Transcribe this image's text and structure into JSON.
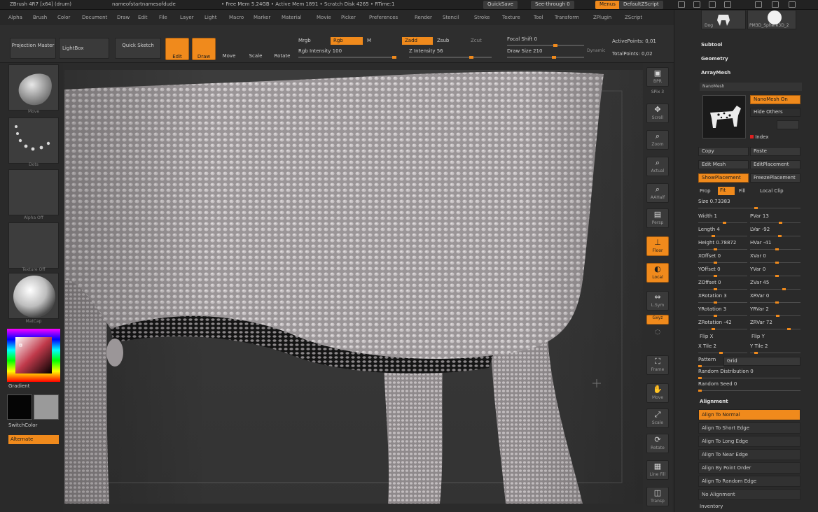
{
  "titlebar": {
    "app_title": "ZBrush 4R7 [x64] (drum)",
    "doc_title": "nameofstartnamesofdude",
    "stats": "• Free Mem 5.24GB • Active Mem 1891 • Scratch Disk 4265 • RTime:1",
    "quicksave": "QuickSave",
    "see_through": "See-through 0",
    "menus_button": "Menus",
    "script_button": "DefaultZScript"
  },
  "menubar": [
    "Alpha",
    "Brush",
    "Color",
    "Document",
    "Draw",
    "Edit",
    "File",
    "Layer",
    "Light",
    "Macro",
    "Marker",
    "Material",
    "Movie",
    "Picker",
    "Preferences",
    "Render",
    "Stencil",
    "Stroke",
    "Texture",
    "Tool",
    "Transform",
    "ZPlugin",
    "ZScript"
  ],
  "shelf": {
    "projection_master": "Projection Master",
    "lightbox": "LightBox",
    "quick_sketch": "Quick Sketch",
    "edit": "Edit",
    "draw": "Draw",
    "move": "Move",
    "scale": "Scale",
    "rotate": "Rotate",
    "mrgb": "Mrgb",
    "rgb": "Rgb",
    "m": "M",
    "zadd": "Zadd",
    "zsub": "Zsub",
    "zcut": "Zcut",
    "rgb_intensity": "Rgb Intensity 100",
    "z_intensity": "Z Intensity 56",
    "focal_shift": "Focal Shift 0",
    "draw_size": "Draw Size 210",
    "dynamic": "Dynamic",
    "active_points": "ActivePoints: 0,01",
    "total_points": "TotalPoints: 0,02"
  },
  "lefttray": {
    "brush_label": "Move",
    "stroke_label": "Dots",
    "alpha_label": "Alpha Off",
    "texture_label": "Texture Off",
    "material_label": "MatCap",
    "gradient": "Gradient",
    "switch_color": "SwitchColor",
    "alternate": "Alternate"
  },
  "rshelf": {
    "bpr": "BPR",
    "spix": "SPix 3",
    "scroll": "Scroll",
    "zoom": "Zoom",
    "actual": "Actual",
    "aahalf": "AAHalf",
    "persp": "Persp",
    "floor": "Floor",
    "local": "Local",
    "lsym": "L.Sym",
    "xyz": "Gxyz",
    "frame": "Frame",
    "move": "Move",
    "scale": "Scale",
    "rotate": "Rotate",
    "linefill": "Line Fill",
    "transp": "Transp"
  },
  "rpanel": {
    "tool_thumb_1": "Dog",
    "tool_thumb_2": "PM3D_Sphere3D_2",
    "subtool": "Subtool",
    "geometry": "Geometry",
    "arraymesh": "ArrayMesh",
    "nanomesh": "NanoMesh",
    "nanomesh_on": "NanoMesh On",
    "hide_others": "Hide Others",
    "index": "Index",
    "copy": "Copy",
    "paste": "Paste",
    "edit_mesh": "Edit Mesh",
    "edit_placement": "EditPlacement",
    "show_placement": "ShowPlacement",
    "freeze_placement": "FreezePlacement",
    "prop": "Prop",
    "fit": "Fit",
    "fill": "Fill",
    "local_clip": "Local Clip",
    "size": "Size 0.73383",
    "sliders": [
      {
        "label": "Width 1",
        "v": 0.55
      },
      {
        "label": "PVar 13",
        "v": 0.62
      },
      {
        "label": "Length 4",
        "v": 0.3
      },
      {
        "label": "LVar -92",
        "v": 0.6
      },
      {
        "label": "Height 0.78872",
        "v": 0.35
      },
      {
        "label": "HVar -41",
        "v": 0.55
      },
      {
        "label": "XOffset 0",
        "v": 0.35
      },
      {
        "label": "XVar 0",
        "v": 0.55
      },
      {
        "label": "YOffset 0",
        "v": 0.35
      },
      {
        "label": "YVar 0",
        "v": 0.55
      },
      {
        "label": "ZOffset 0",
        "v": 0.35
      },
      {
        "label": "ZVar 45",
        "v": 0.7
      },
      {
        "label": "XRotation 3",
        "v": 0.35
      },
      {
        "label": "XRVar 0",
        "v": 0.55
      },
      {
        "label": "YRotation 3",
        "v": 0.35
      },
      {
        "label": "YRVar 2",
        "v": 0.56
      },
      {
        "label": "ZRotation -42",
        "v": 0.3
      },
      {
        "label": "ZRVar 72",
        "v": 0.8
      }
    ],
    "flip_x": "Flip X",
    "flip_y": "Flip Y",
    "x_tile": "X Tile 2",
    "y_tile": "Y Tile 2",
    "pattern": "Pattern",
    "grid": "Grid",
    "random_distribution": "Random Distribution 0",
    "random_seed": "Random Seed 0",
    "alignment": "Alignment",
    "align_items": [
      "Align To Normal",
      "Align To Short Edge",
      "Align To Long Edge",
      "Align To Near Edge",
      "Align By Point Order",
      "Align To Random Edge",
      "No Alignment"
    ],
    "inventory": "Inventory",
    "colors": {
      "accent": "#f08a1c"
    }
  }
}
